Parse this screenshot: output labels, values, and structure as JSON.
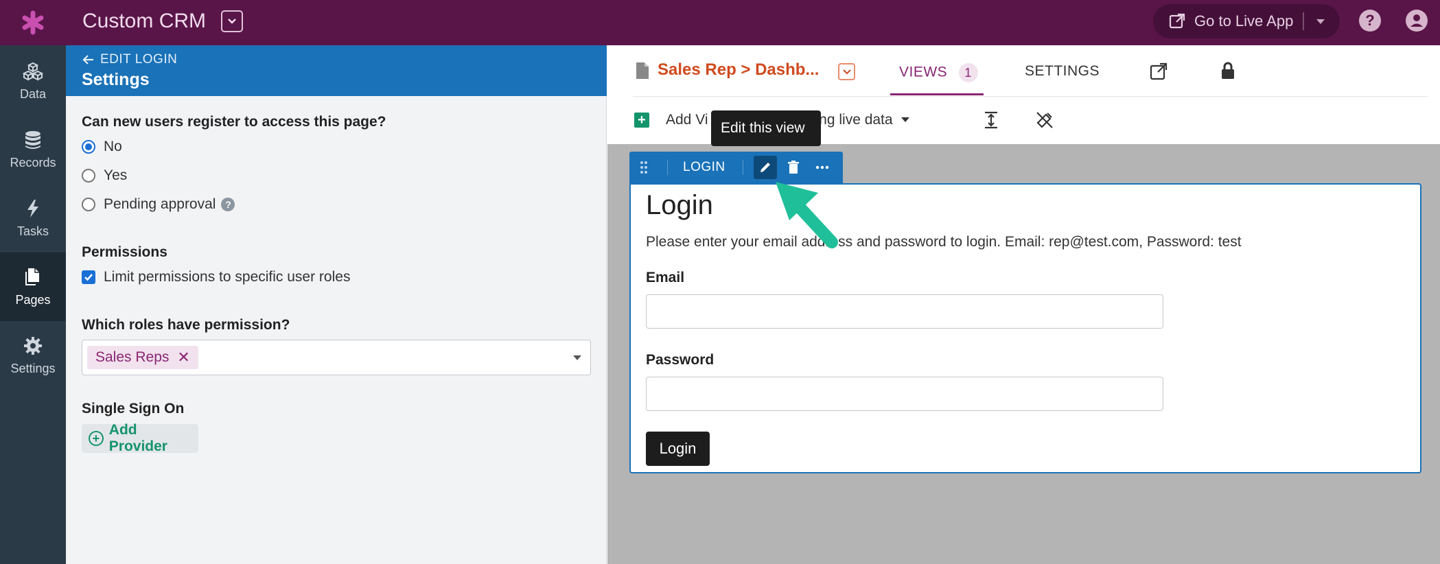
{
  "app": {
    "title": "Custom CRM",
    "live_app_label": "Go to Live App"
  },
  "nav": {
    "items": [
      {
        "label": "Data",
        "icon": "cubes-icon"
      },
      {
        "label": "Records",
        "icon": "database-icon"
      },
      {
        "label": "Tasks",
        "icon": "bolt-icon"
      },
      {
        "label": "Pages",
        "icon": "pages-icon",
        "active": true
      },
      {
        "label": "Settings",
        "icon": "gear-icon"
      }
    ]
  },
  "panel": {
    "back_label": "EDIT LOGIN",
    "title": "Settings",
    "register_question": "Can new users register to access this page?",
    "register_options": [
      "No",
      "Yes",
      "Pending approval"
    ],
    "register_selected": "No",
    "permissions_heading": "Permissions",
    "limit_permissions_label": "Limit permissions to specific user roles",
    "limit_permissions_checked": true,
    "roles_question": "Which roles have permission?",
    "roles_selected": [
      "Sales Reps"
    ],
    "sso_heading": "Single Sign On",
    "add_provider_label": "Add Provider"
  },
  "editor": {
    "page_name": "Sales Rep > Dashb...",
    "tabs": {
      "views_label": "VIEWS",
      "views_count": "1",
      "settings_label": "SETTINGS"
    },
    "add_view_label": "Add Vi",
    "live_data_label": "sing live data",
    "tooltip": "Edit this view",
    "view_toolbar_label": "LOGIN"
  },
  "login_view": {
    "title": "Login",
    "description": "Please enter your email address and password to login. Email: rep@test.com, Password: test",
    "email_label": "Email",
    "password_label": "Password",
    "button_label": "Login"
  },
  "colors": {
    "topbar": "#5a1548",
    "nav": "#2b3a47",
    "accent_blue": "#1a72b8",
    "page_name": "#d04a1e",
    "brand_pink": "#8a2573",
    "arrow": "#1fbf9a"
  }
}
